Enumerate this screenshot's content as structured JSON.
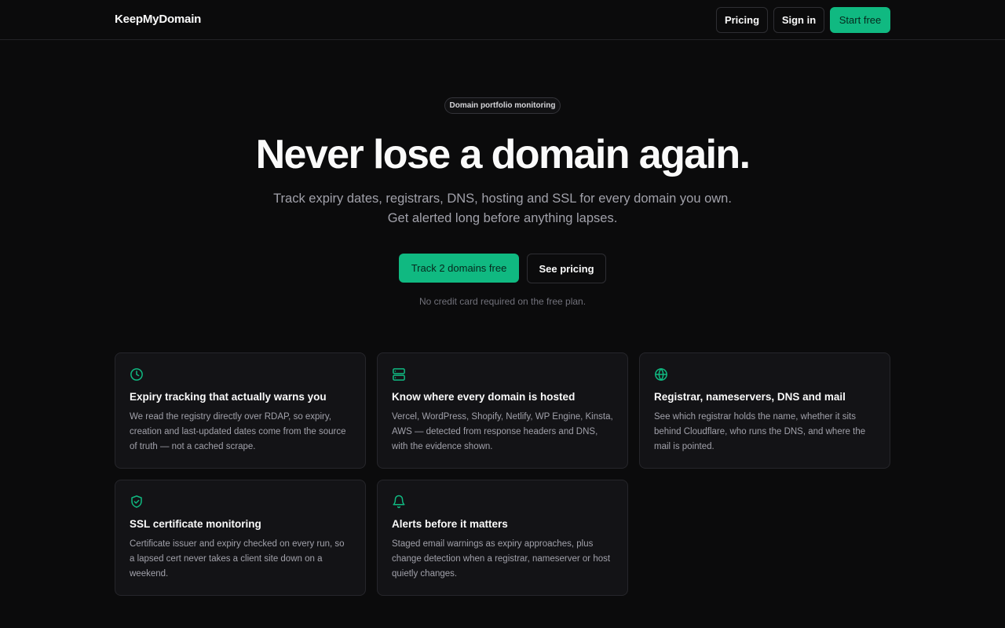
{
  "header": {
    "brand": "KeepMyDomain",
    "nav": {
      "pricing": "Pricing",
      "signin": "Sign in",
      "start": "Start free"
    }
  },
  "hero": {
    "badge": "Domain portfolio monitoring",
    "title": "Never lose a domain again.",
    "subtitle": "Track expiry dates, registrars, DNS, hosting and SSL for every domain you own. Get alerted long before anything lapses.",
    "primary_cta": "Track 2 domains free",
    "secondary_cta": "See pricing",
    "note": "No credit card required on the free plan."
  },
  "features": [
    {
      "icon": "clock-icon",
      "title": "Expiry tracking that actually warns you",
      "body": "We read the registry directly over RDAP, so expiry, creation and last-updated dates come from the source of truth — not a cached scrape."
    },
    {
      "icon": "server-icon",
      "title": "Know where every domain is hosted",
      "body": "Vercel, WordPress, Shopify, Netlify, WP Engine, Kinsta, AWS — detected from response headers and DNS, with the evidence shown."
    },
    {
      "icon": "globe-icon",
      "title": "Registrar, nameservers, DNS and mail",
      "body": "See which registrar holds the name, whether it sits behind Cloudflare, who runs the DNS, and where the mail is pointed."
    },
    {
      "icon": "shield-check-icon",
      "title": "SSL certificate monitoring",
      "body": "Certificate issuer and expiry checked on every run, so a lapsed cert never takes a client site down on a weekend."
    },
    {
      "icon": "bell-icon",
      "title": "Alerts before it matters",
      "body": "Staged email warnings as expiry approaches, plus change detection when a registrar, nameserver or host quietly changes."
    }
  ],
  "colors": {
    "background": "#0b0b0c",
    "accent": "#10b981",
    "card": "#131316",
    "border": "#26262b",
    "muted_text": "#a1a1aa"
  }
}
